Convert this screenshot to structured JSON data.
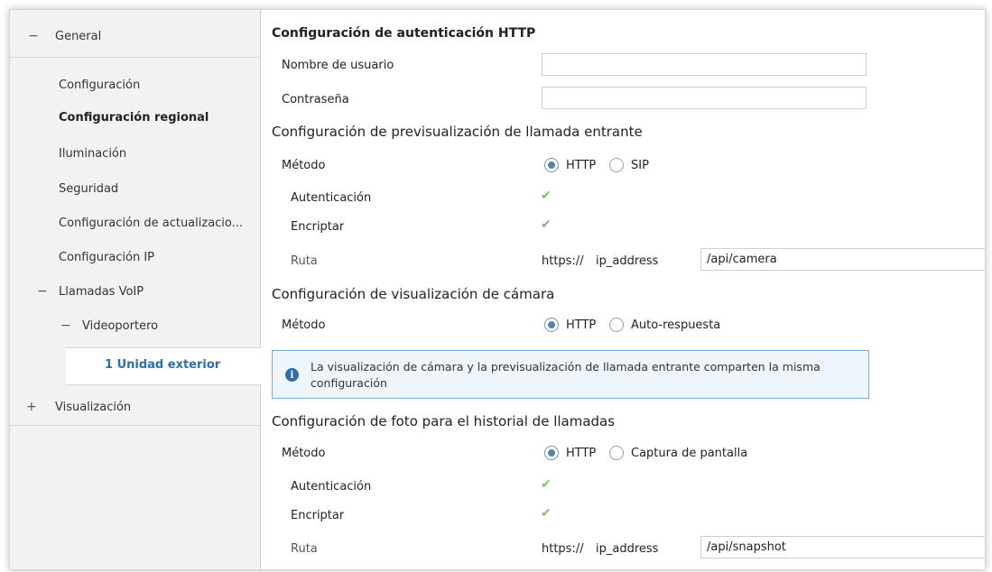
{
  "sidebar": {
    "general": {
      "sign": "−",
      "label": "General"
    },
    "items": [
      {
        "label": "Configuración"
      },
      {
        "label": "Configuración regional"
      },
      {
        "label": "Iluminación"
      },
      {
        "label": "Seguridad"
      },
      {
        "label": "Configuración de actualizacio..."
      },
      {
        "label": "Configuración IP"
      }
    ],
    "voip": {
      "sign": "−",
      "label": "Llamadas VoIP"
    },
    "videoportero": {
      "sign": "−",
      "label": "Videoportero"
    },
    "selected": {
      "label": "1 Unidad exterior"
    },
    "visualizacion": {
      "sign": "+",
      "label": "Visualización"
    }
  },
  "http_auth": {
    "title": "Configuración de autenticación HTTP",
    "username_label": "Nombre de usuario",
    "username_value": "",
    "password_label": "Contraseña",
    "password_value": ""
  },
  "preview": {
    "title": "Configuración de previsualización de llamada entrante",
    "method_label": "Método",
    "options": [
      "HTTP",
      "SIP"
    ],
    "selected": "HTTP",
    "auth_label": "Autenticación",
    "auth_checked": true,
    "encrypt_label": "Encriptar",
    "encrypt_checked": true,
    "route_label": "Ruta",
    "route_prefix": "https://",
    "route_host": "ip_address",
    "route_value": "/api/camera"
  },
  "camera": {
    "title": "Configuración de visualización de cámara",
    "method_label": "Método",
    "options": [
      "HTTP",
      "Auto-respuesta"
    ],
    "selected": "HTTP",
    "info": "La visualización de cámara y la previsualización de llamada entrante comparten la misma configuración"
  },
  "photo": {
    "title": "Configuración de foto para el historial de llamadas",
    "method_label": "Método",
    "options": [
      "HTTP",
      "Captura de pantalla"
    ],
    "selected": "HTTP",
    "auth_label": "Autenticación",
    "auth_checked": true,
    "encrypt_label": "Encriptar",
    "encrypt_checked": true,
    "route_label": "Ruta",
    "route_prefix": "https://",
    "route_host": "ip_address",
    "route_value": "/api/snapshot"
  },
  "icons": {
    "check": "check-icon",
    "info": "info-icon"
  }
}
